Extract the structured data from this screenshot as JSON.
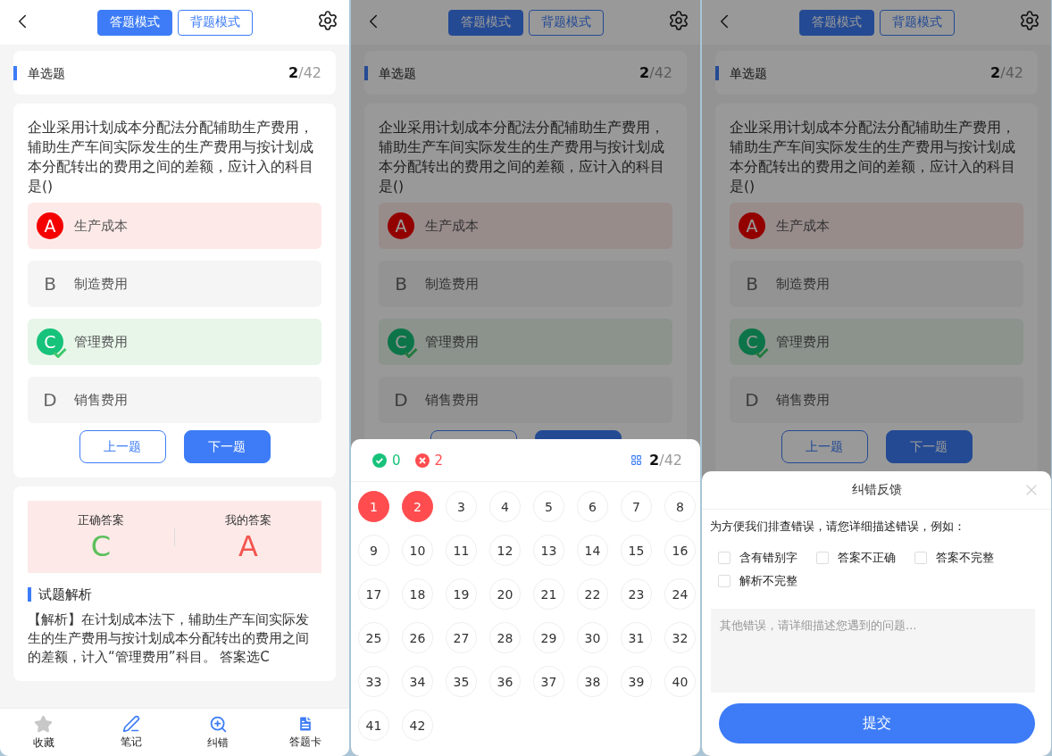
{
  "screens": [
    {
      "header": {
        "tabs": [
          {
            "label": "答题模式",
            "selected": true
          },
          {
            "label": "背题模式",
            "selected": false
          }
        ]
      },
      "type_card": {
        "title": "单选题",
        "current": "2",
        "total": "/42"
      },
      "question": "企业采用计划成本分配法分配辅助生产费用，辅助生产车间实际发生的生产费用与按计划成本分配转出的费用之间的差额，应计入的科目是()",
      "options": [
        {
          "letter": "A",
          "text": "生产成本",
          "picked": true,
          "correct": false
        },
        {
          "letter": "B",
          "text": "制造费用",
          "picked": false,
          "correct": false
        },
        {
          "letter": "C",
          "text": "管理费用",
          "picked": false,
          "correct": true
        },
        {
          "letter": "D",
          "text": "销售费用",
          "picked": false,
          "correct": false
        }
      ],
      "nav_buttons": [
        {
          "label": "上一题",
          "kind": "outline"
        },
        {
          "label": "下一题",
          "kind": "filled"
        }
      ],
      "result": {
        "correct_label": "正确答案",
        "correct_value": "C",
        "my_label": "我的答案",
        "my_value": "A"
      },
      "analysis": {
        "title": "试题解析",
        "text": "【解析】在计划成本法下，辅助生产车间实际发生的生产费用与按计划成本分配转出的费用之间的差额，计入“管理费用”科目。 答案选C"
      },
      "bottom_bar": [
        {
          "label": "收藏",
          "kind": "star"
        },
        {
          "label": "笔记",
          "kind": "pen"
        },
        {
          "label": "纠错",
          "kind": "zoom"
        },
        {
          "label": "答题卡",
          "kind": "card"
        }
      ],
      "sheet": {
        "kind": "none"
      }
    },
    {
      "header": {
        "tabs": [
          {
            "label": "答题模式",
            "selected": true
          },
          {
            "label": "背题模式",
            "selected": false
          }
        ]
      },
      "type_card": {
        "title": "单选题",
        "current": "2",
        "total": "/42"
      },
      "question": "企业采用计划成本分配法分配辅助生产费用，辅助生产车间实际发生的生产费用与按计划成本分配转出的费用之间的差额，应计入的科目是()",
      "options": [
        {
          "letter": "A",
          "text": "生产成本",
          "picked": true,
          "correct": false
        },
        {
          "letter": "B",
          "text": "制造费用",
          "picked": false,
          "correct": false
        },
        {
          "letter": "C",
          "text": "管理费用",
          "picked": false,
          "correct": true
        },
        {
          "letter": "D",
          "text": "销售费用",
          "picked": false,
          "correct": false
        }
      ],
      "nav_buttons": [
        {
          "kind": "outline"
        },
        {
          "kind": "filled"
        }
      ],
      "sheet": {
        "kind": "answer_card",
        "correct_count": "0",
        "wrong_count": "2",
        "current": "2",
        "total": "/42",
        "items": [
          {
            "number": "1",
            "wrong": true
          },
          {
            "number": "2",
            "wrong": true
          },
          {
            "number": "3",
            "wrong": false
          },
          {
            "number": "4",
            "wrong": false
          },
          {
            "number": "5",
            "wrong": false
          },
          {
            "number": "6",
            "wrong": false
          },
          {
            "number": "7",
            "wrong": false
          },
          {
            "number": "8",
            "wrong": false
          },
          {
            "number": "9",
            "wrong": false
          },
          {
            "number": "10",
            "wrong": false
          },
          {
            "number": "11",
            "wrong": false
          },
          {
            "number": "12",
            "wrong": false
          },
          {
            "number": "13",
            "wrong": false
          },
          {
            "number": "14",
            "wrong": false
          },
          {
            "number": "15",
            "wrong": false
          },
          {
            "number": "16",
            "wrong": false
          },
          {
            "number": "17",
            "wrong": false
          },
          {
            "number": "18",
            "wrong": false
          },
          {
            "number": "19",
            "wrong": false
          },
          {
            "number": "20",
            "wrong": false
          },
          {
            "number": "21",
            "wrong": false
          },
          {
            "number": "22",
            "wrong": false
          },
          {
            "number": "23",
            "wrong": false
          },
          {
            "number": "24",
            "wrong": false
          },
          {
            "number": "25",
            "wrong": false
          },
          {
            "number": "26",
            "wrong": false
          },
          {
            "number": "27",
            "wrong": false
          },
          {
            "number": "28",
            "wrong": false
          },
          {
            "number": "29",
            "wrong": false
          },
          {
            "number": "30",
            "wrong": false
          },
          {
            "number": "31",
            "wrong": false
          },
          {
            "number": "32",
            "wrong": false
          },
          {
            "number": "33",
            "wrong": false
          },
          {
            "number": "34",
            "wrong": false
          },
          {
            "number": "35",
            "wrong": false
          },
          {
            "number": "36",
            "wrong": false
          },
          {
            "number": "37",
            "wrong": false
          },
          {
            "number": "38",
            "wrong": false
          },
          {
            "number": "39",
            "wrong": false
          },
          {
            "number": "40",
            "wrong": false
          },
          {
            "number": "41",
            "wrong": false
          },
          {
            "number": "42",
            "wrong": false
          }
        ]
      }
    },
    {
      "header": {
        "tabs": [
          {
            "label": "答题模式",
            "selected": true
          },
          {
            "label": "背题模式",
            "selected": false
          }
        ]
      },
      "type_card": {
        "title": "单选题",
        "current": "2",
        "total": "/42"
      },
      "question": "企业采用计划成本分配法分配辅助生产费用，辅助生产车间实际发生的生产费用与按计划成本分配转出的费用之间的差额，应计入的科目是()",
      "options": [
        {
          "letter": "A",
          "text": "生产成本",
          "picked": true,
          "correct": false
        },
        {
          "letter": "B",
          "text": "制造费用",
          "picked": false,
          "correct": false
        },
        {
          "letter": "C",
          "text": "管理费用",
          "picked": false,
          "correct": true
        },
        {
          "letter": "D",
          "text": "销售费用",
          "picked": false,
          "correct": false
        }
      ],
      "nav_buttons": [
        {
          "label": "上一题",
          "kind": "outline"
        },
        {
          "label": "下一题",
          "kind": "filled"
        }
      ],
      "sheet": {
        "kind": "feedback",
        "title": "纠错反馈",
        "description": "为方便我们排查错误，请您详细描述错误，例如：",
        "choices": [
          {
            "label": "含有错别字",
            "checked": false
          },
          {
            "label": "答案不正确",
            "checked": false
          },
          {
            "label": "答案不完整",
            "checked": false
          },
          {
            "label": "解析不完整",
            "checked": false
          }
        ],
        "placeholder": "其他错误，请详细描述您遇到的问题...",
        "submit": "提交"
      }
    }
  ]
}
